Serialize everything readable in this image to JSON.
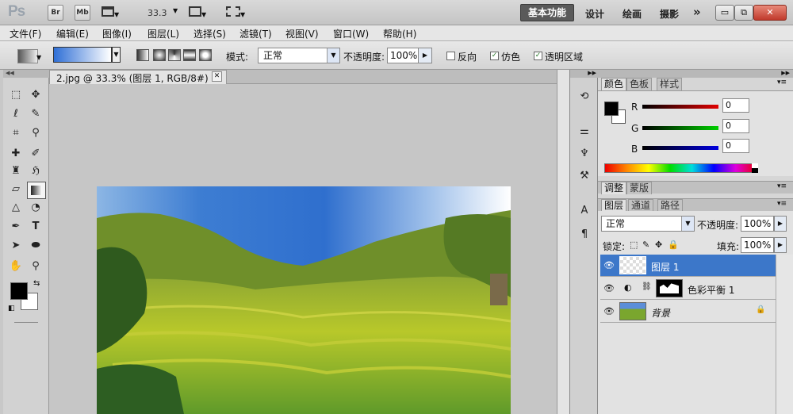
{
  "titlebar": {
    "logo": "Ps",
    "br": "Br",
    "mb": "Mb",
    "zoom": "33.3",
    "workspaces": [
      "基本功能",
      "设计",
      "绘画",
      "摄影"
    ],
    "more": "»",
    "minimize": "▭",
    "restore": "⧉",
    "close": "✕"
  },
  "menus": [
    "文件(F)",
    "编辑(E)",
    "图像(I)",
    "图层(L)",
    "选择(S)",
    "滤镜(T)",
    "视图(V)",
    "窗口(W)",
    "帮助(H)"
  ],
  "options": {
    "mode_label": "模式:",
    "mode_value": "正常",
    "opacity_label": "不透明度:",
    "opacity_value": "100%",
    "reverse": "反向",
    "dither": "仿色",
    "transparency": "透明区域",
    "reverse_checked": false,
    "dither_checked": true,
    "transparency_checked": true
  },
  "document": {
    "tab_title": "2.jpg @ 33.3% (图层 1, RGB/8#) *",
    "tab_close": "✕"
  },
  "color_panel": {
    "tabs": [
      "颜色",
      "色板",
      "样式"
    ],
    "r_label": "R",
    "g_label": "G",
    "b_label": "B",
    "r": "0",
    "g": "0",
    "b": "0"
  },
  "adjust_panel": {
    "tabs": [
      "调整",
      "蒙版"
    ]
  },
  "layers_panel": {
    "tabs": [
      "图层",
      "通道",
      "路径"
    ],
    "blend_mode": "正常",
    "opacity_label": "不透明度:",
    "opacity": "100%",
    "lock_label": "锁定:",
    "fill_label": "填充:",
    "fill": "100%",
    "layers": [
      {
        "name": "图层 1",
        "selected": true
      },
      {
        "name": "色彩平衡 1",
        "selected": false
      },
      {
        "name": "背景",
        "selected": false
      }
    ]
  },
  "colors": {
    "accent_selected": "#3c77c9",
    "foreground": "#000000",
    "background": "#ffffff"
  }
}
